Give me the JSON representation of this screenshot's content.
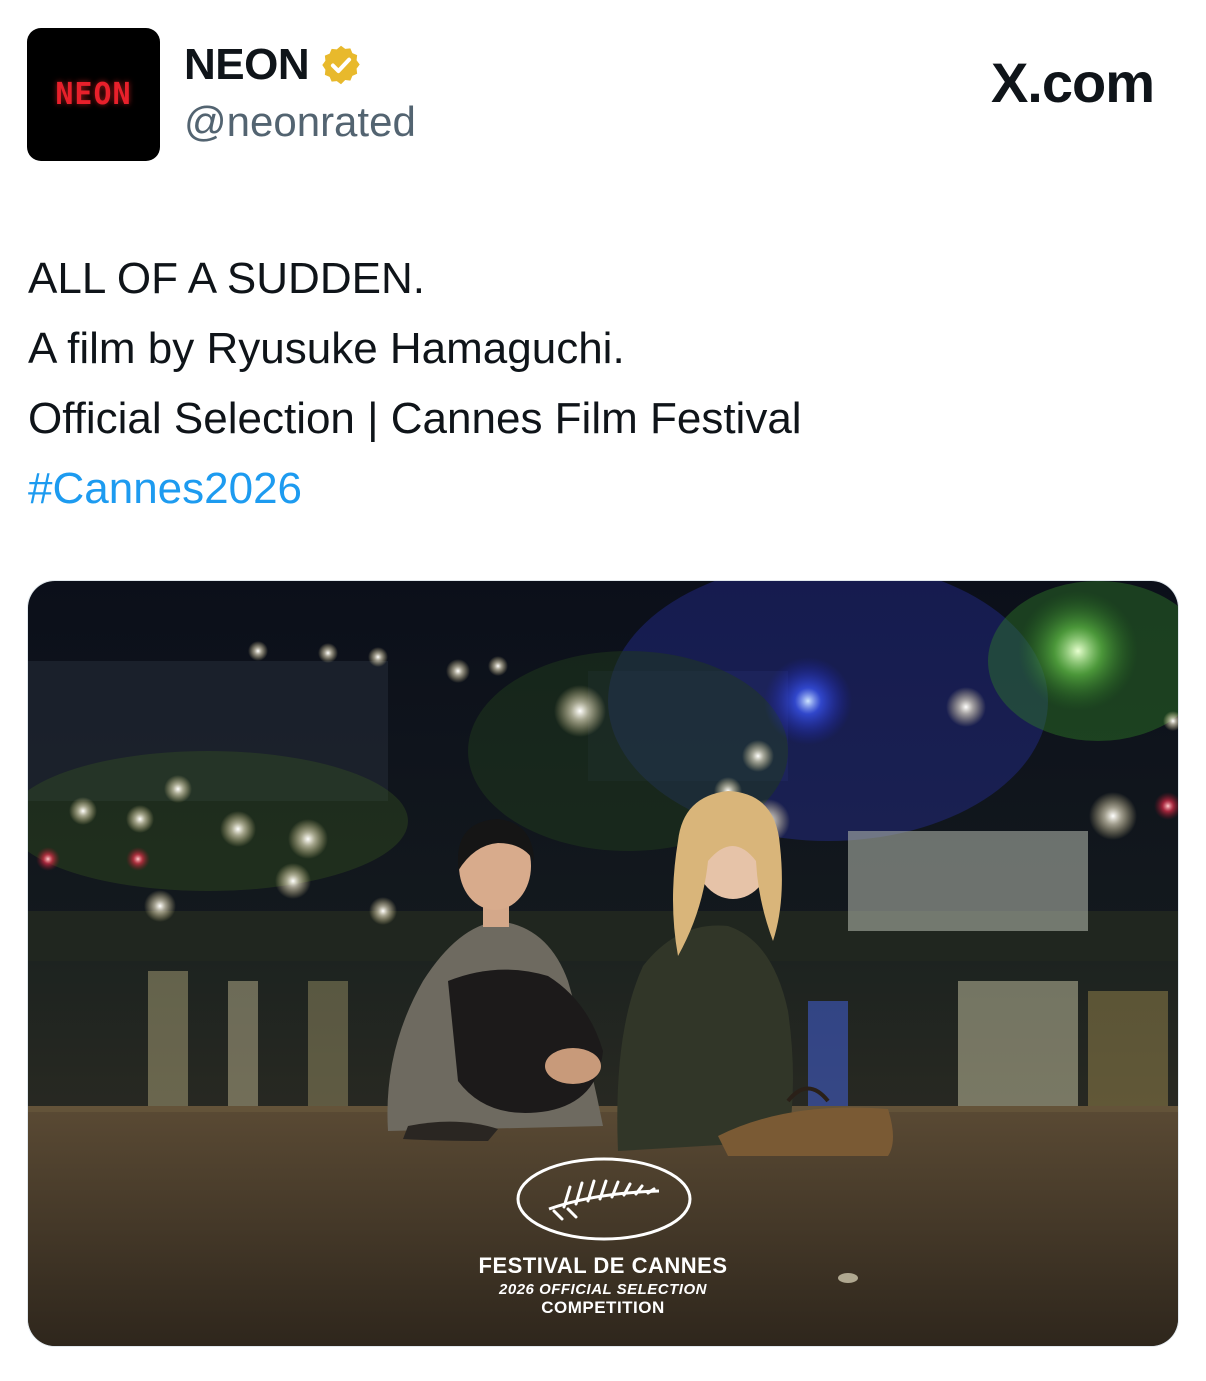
{
  "header": {
    "avatar_text": "NEON",
    "display_name": "NEON",
    "handle": "@neonrated",
    "brand": "X.com"
  },
  "tweet": {
    "lines": [
      "ALL OF A SUDDEN.",
      "A film by Ryusuke Hamaguchi.",
      "Official Selection | Cannes Film Festival"
    ],
    "hashtag": "#Cannes2026"
  },
  "media": {
    "badge_title": "FESTIVAL DE CANNES",
    "badge_subtitle": "2026 OFFICIAL SELECTION",
    "badge_category": "COMPETITION"
  },
  "colors": {
    "hashtag": "#1d9bf0",
    "verified_badge": "#e8b92c",
    "avatar_bg": "#000000",
    "avatar_text": "#e8202b"
  },
  "icons": [
    "verified-badge-icon",
    "palm-leaf-icon"
  ]
}
